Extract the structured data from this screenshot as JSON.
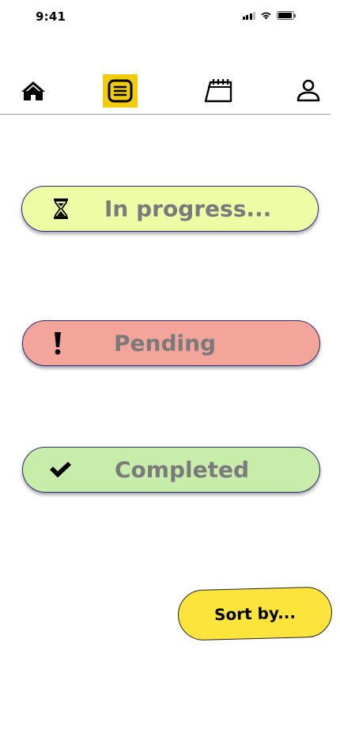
{
  "status_bar": {
    "time": "9:41"
  },
  "nav": {
    "items": [
      {
        "name": "home",
        "icon": "home-icon"
      },
      {
        "name": "list",
        "icon": "list-icon",
        "active": true
      },
      {
        "name": "calendar",
        "icon": "calendar-icon"
      },
      {
        "name": "profile",
        "icon": "profile-icon"
      }
    ],
    "active_color": "#f1cc0d"
  },
  "statuses": {
    "in_progress": {
      "label": "In progress...",
      "icon": "hourglass-icon",
      "color": "#eefca6"
    },
    "pending": {
      "label": "Pending",
      "icon": "exclamation-icon",
      "color": "#f4a59b"
    },
    "completed": {
      "label": "Completed",
      "icon": "checkmark-icon",
      "color": "#c8ecaa"
    }
  },
  "sort": {
    "label": "Sort by...",
    "color": "#fde43d"
  }
}
